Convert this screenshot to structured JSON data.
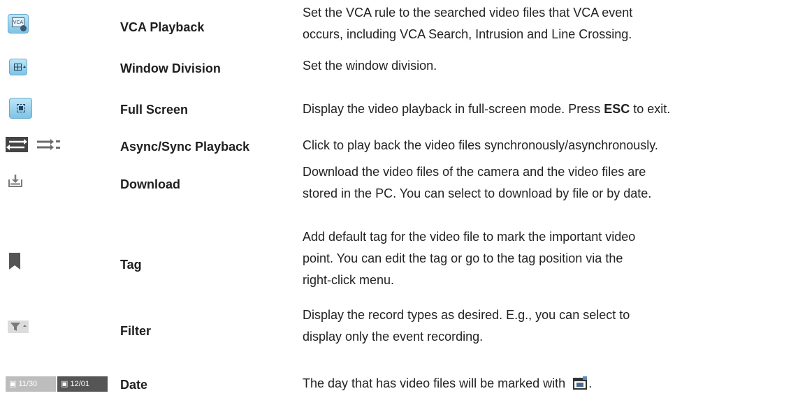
{
  "rows": [
    {
      "name": "VCA Playback",
      "icon": "vca-playback-icon",
      "icon_text": "VCA",
      "desc": [
        "Set the VCA rule to the searched video files that VCA event",
        "occurs, including VCA Search, Intrusion and Line Crossing."
      ]
    },
    {
      "name": "Window Division",
      "icon": "window-division-icon",
      "desc": [
        "Set the window division."
      ]
    },
    {
      "name": "Full Screen",
      "icon": "full-screen-icon",
      "desc_pre": "Display the video playback in full-screen mode. Press ",
      "desc_bold": "ESC",
      "desc_post": " to exit."
    },
    {
      "name": "Async/Sync Playback",
      "icon": "async-sync-icon",
      "desc": [
        "Click to play back the video files synchronously/asynchronously."
      ]
    },
    {
      "name": "Download",
      "icon": "download-icon",
      "desc": [
        "Download the video files of the camera and the video files are",
        "stored in the PC. You can select to download by file or by date."
      ]
    },
    {
      "name": "Tag",
      "icon": "bookmark-icon",
      "desc": [
        "Add default tag for the video file to mark the important video",
        "point. You can edit the tag or go to the tag position via the",
        "right-click menu."
      ]
    },
    {
      "name": "Filter",
      "icon": "filter-icon",
      "desc": [
        "Display the record types as desired. E.g., you can select to",
        "display only the event recording."
      ]
    },
    {
      "name": "Date",
      "icon": "calendar-date-icon",
      "dates": [
        "11/30",
        "12/01"
      ],
      "desc": [
        "The day that has video files will be marked with"
      ],
      "desc_end": "."
    }
  ],
  "colors": {
    "button_blue_top": "#bfe6f8",
    "button_blue_bottom": "#7cc3e6",
    "icon_grey": "#9a9a9a",
    "date_dark": "#555555",
    "date_light": "#bdbdbd"
  }
}
